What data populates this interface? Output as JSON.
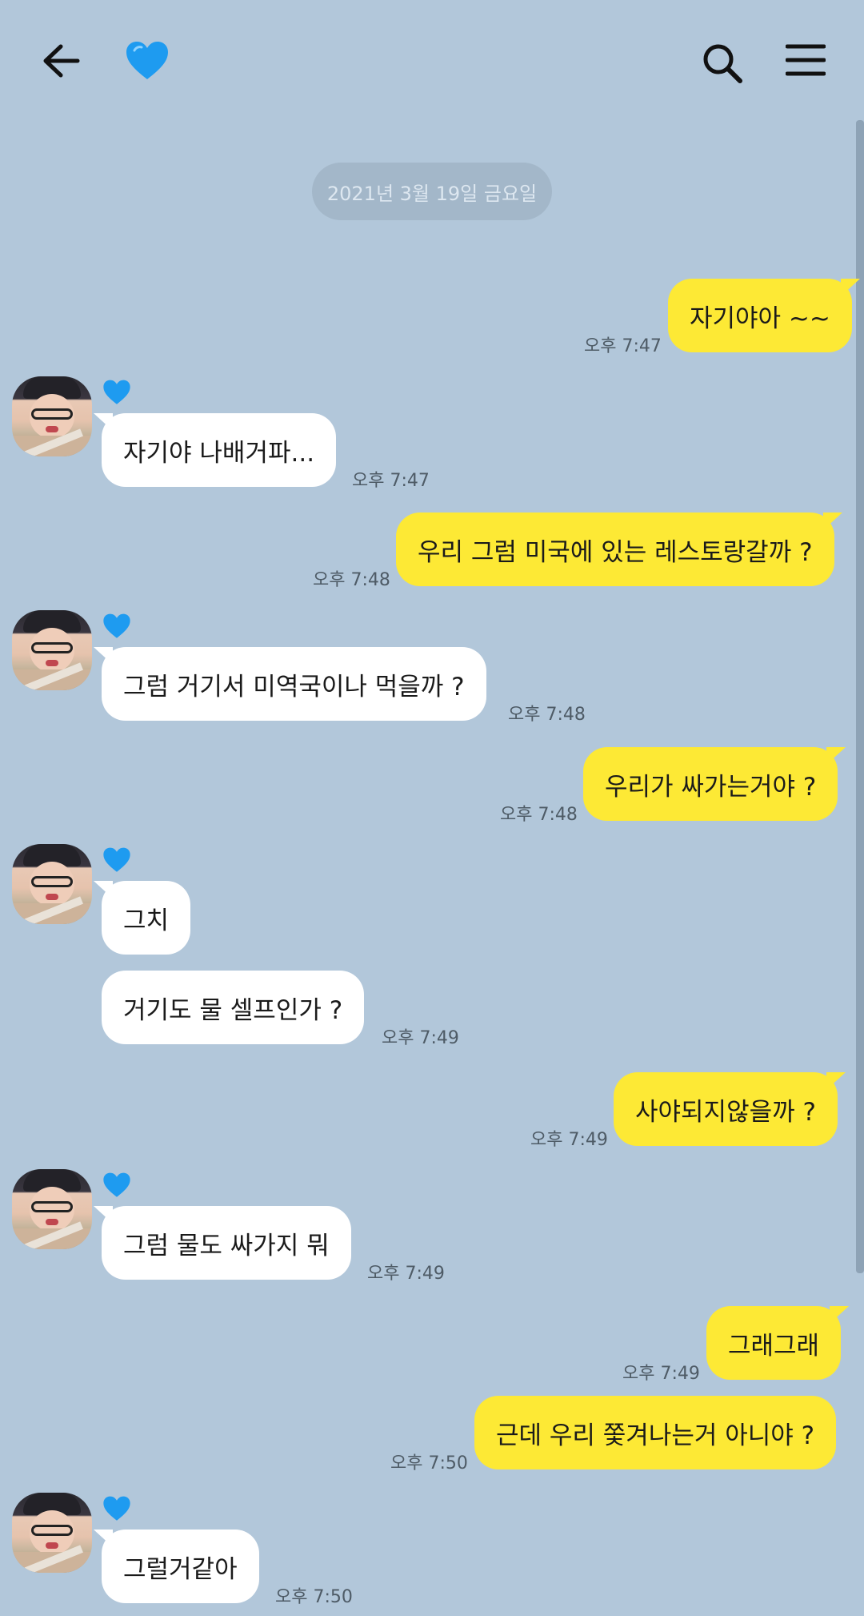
{
  "header": {
    "back_icon": "arrow-left-icon",
    "title_icon": "blue-heart-icon",
    "search_icon": "search-icon",
    "menu_icon": "hamburger-menu-icon"
  },
  "date_divider": "2021년 3월 19일 금요일",
  "colors": {
    "background": "#b2c7da",
    "my_bubble": "#fde935",
    "their_bubble": "#ffffff",
    "heart": "#1e9bf0"
  },
  "messages": [
    {
      "sender": "me",
      "text": "자기야아 ~~",
      "time": "오후 7:47"
    },
    {
      "sender": "them",
      "text": "자기야 나배거파...",
      "time": "오후 7:47"
    },
    {
      "sender": "me",
      "text": "우리 그럼 미국에 있는 레스토랑갈까 ?",
      "time": "오후 7:48"
    },
    {
      "sender": "them",
      "text": "그럼 거기서 미역국이나 먹을까 ?",
      "time": "오후 7:48"
    },
    {
      "sender": "me",
      "text": "우리가 싸가는거야 ?",
      "time": "오후 7:48"
    },
    {
      "sender": "them",
      "text": "그치",
      "time": ""
    },
    {
      "sender": "them",
      "text": "거기도 물 셀프인가 ?",
      "time": "오후 7:49"
    },
    {
      "sender": "me",
      "text": "사야되지않을까 ?",
      "time": "오후 7:49"
    },
    {
      "sender": "them",
      "text": "그럼 물도 싸가지 뭐",
      "time": "오후 7:49"
    },
    {
      "sender": "me",
      "text": "그래그래",
      "time": "오후 7:49"
    },
    {
      "sender": "me",
      "text": "근데 우리 쫓겨나는거 아니야 ?",
      "time": "오후 7:50"
    },
    {
      "sender": "them",
      "text": "그럴거같아",
      "time": "오후 7:50"
    }
  ]
}
